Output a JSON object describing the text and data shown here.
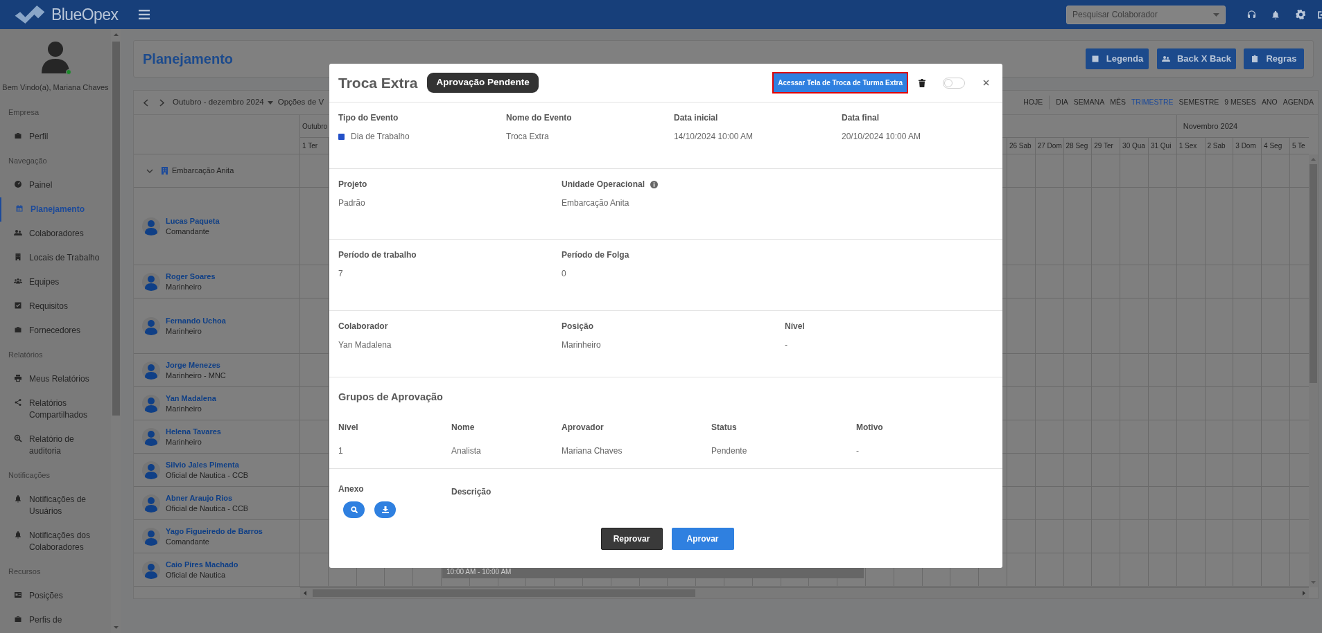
{
  "topbar": {
    "brand": "BlueOpex",
    "search": {
      "placeholder": "Pesquisar Colaborador"
    }
  },
  "sidebar": {
    "welcome": "Bem Vindo(a), Mariana Chaves",
    "online": true,
    "sections": [
      {
        "title": "Empresa",
        "items": [
          {
            "label": "Perfil",
            "selected": false
          }
        ]
      },
      {
        "title": "Navegação",
        "items": [
          {
            "label": "Painel",
            "selected": false
          },
          {
            "label": "Planejamento",
            "selected": true
          },
          {
            "label": "Colaboradores",
            "selected": false
          },
          {
            "label": "Locais de Trabalho",
            "selected": false
          },
          {
            "label": "Equipes",
            "selected": false
          },
          {
            "label": "Requisitos",
            "selected": false
          },
          {
            "label": "Fornecedores",
            "selected": false
          }
        ]
      },
      {
        "title": "Relatórios",
        "items": [
          {
            "label": "Meus Relatórios",
            "selected": false
          },
          {
            "label": "Relatórios Compartilhados",
            "selected": false
          },
          {
            "label": "Relatório de auditoria",
            "selected": false
          }
        ]
      },
      {
        "title": "Notificações",
        "items": [
          {
            "label": "Notificações de Usuários",
            "selected": false
          },
          {
            "label": "Notificações dos Colaboradores",
            "selected": false
          }
        ]
      },
      {
        "title": "Recursos",
        "items": [
          {
            "label": "Posições",
            "selected": false
          },
          {
            "label": "Perfis de",
            "selected": false
          }
        ]
      }
    ]
  },
  "page": {
    "title": "Planejamento",
    "buttons": [
      {
        "label": "Legenda"
      },
      {
        "label": "Back X Back"
      },
      {
        "label": "Regras"
      }
    ]
  },
  "calendar": {
    "range": "Outubro - dezembro 2024",
    "options": "Opções de V",
    "views": [
      {
        "label": "HOJE",
        "selected": false
      },
      {
        "label": "DIA",
        "selected": false
      },
      {
        "label": "SEMANA",
        "selected": false
      },
      {
        "label": "MÊS",
        "selected": false
      },
      {
        "label": "TRIMESTRE",
        "selected": true
      },
      {
        "label": "SEMESTRE",
        "selected": false
      },
      {
        "label": "9 MESES",
        "selected": false
      },
      {
        "label": "ANO",
        "selected": false
      },
      {
        "label": "AGENDA",
        "selected": false
      }
    ],
    "months": [
      "Outubro",
      "Novembro 2024"
    ],
    "days_start": [
      "1 Ter"
    ],
    "days_end": [
      "26 Sab",
      "27 Dom",
      "28 Seg",
      "29 Ter",
      "30 Qua",
      "31 Qui",
      "1 Sex",
      "2 Sab",
      "3 Dom",
      "4 Seg",
      "5 Te"
    ],
    "group": {
      "label": "Embarcação Anita",
      "expanded": true
    },
    "people": [
      {
        "name": "Lucas Paqueta",
        "role": "Comandante"
      },
      {
        "name": "Roger Soares",
        "role": "Marinheiro"
      },
      {
        "name": "Fernando Uchoa",
        "role": "Marinheiro"
      },
      {
        "name": "Jorge Menezes",
        "role": "Marinheiro - MNC"
      },
      {
        "name": "Yan Madalena",
        "role": "Marinheiro"
      },
      {
        "name": "Helena Tavares",
        "role": "Marinheiro"
      },
      {
        "name": "Silvio Jales Pimenta",
        "role": "Oficial de Nautica - CCB"
      },
      {
        "name": "Abner Araujo Rios",
        "role": "Oficial de Nautica - CCB"
      },
      {
        "name": "Yago Figueiredo de Barros",
        "role": "Comandante"
      },
      {
        "name": "Caio Pires Machado",
        "role": "Oficial de Nautica"
      }
    ],
    "event_bar": {
      "time": "10:00 AM - 10:00 AM"
    }
  },
  "modal": {
    "title": "Troca Extra",
    "badge": "Aprovação Pendente",
    "action": "Acessar Tela de Troca de Turma Extra",
    "toggle": {
      "on": false
    },
    "sections": [
      {
        "fields": [
          {
            "label": "Tipo do Evento",
            "value": "Dia de Trabalho",
            "color": "#2350c8"
          },
          {
            "label": "Nome do Evento",
            "value": "Troca Extra"
          },
          {
            "label": "Data inicial",
            "value": "14/10/2024 10:00 AM"
          },
          {
            "label": "Data final",
            "value": "20/10/2024 10:00 AM"
          }
        ]
      },
      {
        "fields": [
          {
            "label": "Projeto",
            "value": "Padrão"
          },
          {
            "label": "Unidade Operacional",
            "value": "Embarcação Anita",
            "info": true
          }
        ]
      },
      {
        "fields": [
          {
            "label": "Período de trabalho",
            "value": "7"
          },
          {
            "label": "Período de Folga",
            "value": "0"
          }
        ]
      },
      {
        "fields": [
          {
            "label": "Colaborador",
            "value": "Yan Madalena"
          },
          {
            "label": "Posição",
            "value": "Marinheiro"
          },
          {
            "label": "Nível",
            "value": "-"
          }
        ]
      }
    ],
    "approval": {
      "title": "Grupos de Aprovação",
      "columns": [
        "Nível",
        "Nome",
        "Aprovador",
        "Status",
        "Motivo"
      ],
      "rows": [
        [
          "1",
          "Analista",
          "Mariana Chaves",
          "Pendente",
          "-"
        ]
      ]
    },
    "attachment": {
      "label": "Anexo",
      "description_label": "Descrição"
    },
    "buttons": [
      {
        "label": "Reprovar",
        "kind": "reject"
      },
      {
        "label": "Aprovar",
        "kind": "approve"
      }
    ]
  }
}
